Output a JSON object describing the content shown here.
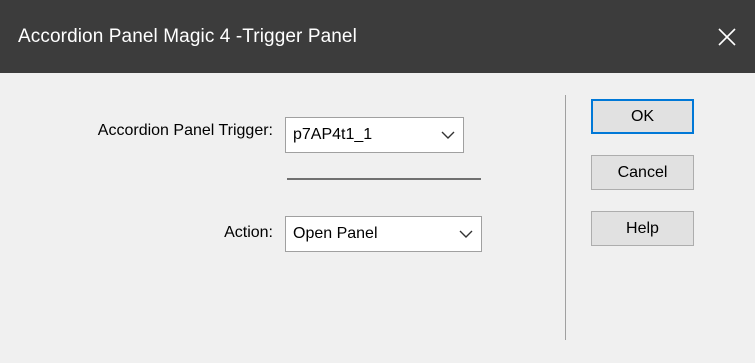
{
  "window": {
    "title": "Accordion Panel Magic 4 -Trigger Panel",
    "close_icon": "close-icon"
  },
  "form": {
    "trigger_label": "Accordion Panel Trigger:",
    "trigger_value": "p7AP4t1_1",
    "action_label": "Action:",
    "action_value": "Open Panel"
  },
  "buttons": {
    "ok": "OK",
    "cancel": "Cancel",
    "help": "Help"
  },
  "colors": {
    "titlebar": "#3c3c3c",
    "dialog_bg": "#f0f0f0",
    "default_button_border": "#0078d7"
  }
}
